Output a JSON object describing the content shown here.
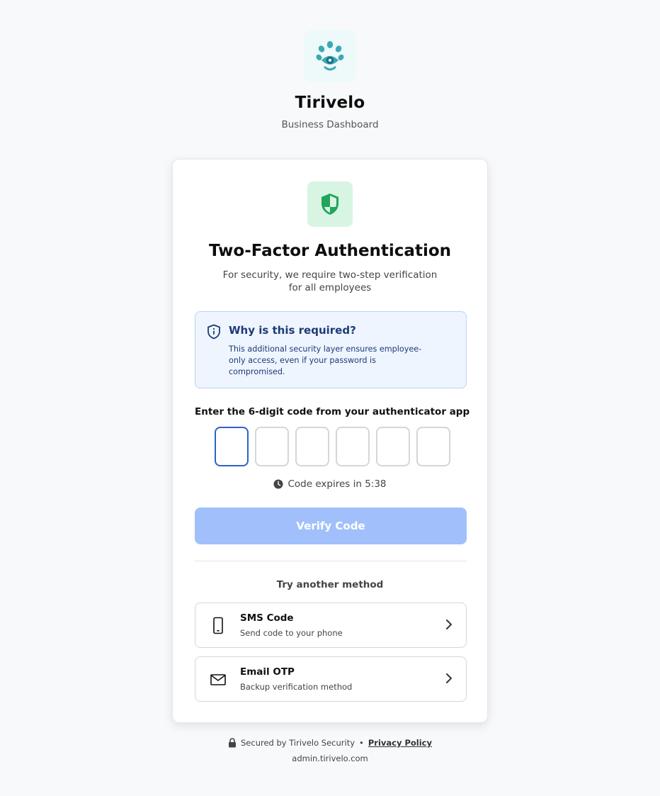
{
  "brand": {
    "logo_icon": "paw-eye-logo-icon",
    "name": "Tirivelo",
    "subtitle": "Business Dashboard"
  },
  "card": {
    "icon": "shield-icon",
    "title": "Two-Factor Authentication",
    "subtitle": "For security, we require two-step verification for all employees",
    "info": {
      "icon": "shield-info-icon",
      "title": "Why is this required?",
      "text": "This additional security layer ensures employee- only access, even if your password is compromised."
    },
    "code_label": "Enter the 6-digit code from your authenticator app",
    "otp_values": [
      "",
      "",
      "",
      "",
      "",
      ""
    ],
    "expires_text": "Code expires in 5:38",
    "verify_label": "Verify Code",
    "other_methods_label": "Try another method",
    "methods": [
      {
        "icon": "phone-icon",
        "title": "SMS Code",
        "description": "Send code to your phone"
      },
      {
        "icon": "mail-icon",
        "title": "Email OTP",
        "description": "Backup verification method"
      }
    ]
  },
  "footer": {
    "secured_text": "Secured by Tirivelo Security",
    "separator": "•",
    "privacy_label": "Privacy Policy",
    "domain": "admin.tirivelo.com"
  },
  "colors": {
    "background": "#f8f9fb",
    "brand_teal": "#3aa9b4",
    "shield_green": "#22a55a",
    "info_bg": "#eef5fe",
    "info_text": "#1f3a78",
    "active_input": "#2f62c4",
    "verify_disabled": "#a1c0fb"
  }
}
